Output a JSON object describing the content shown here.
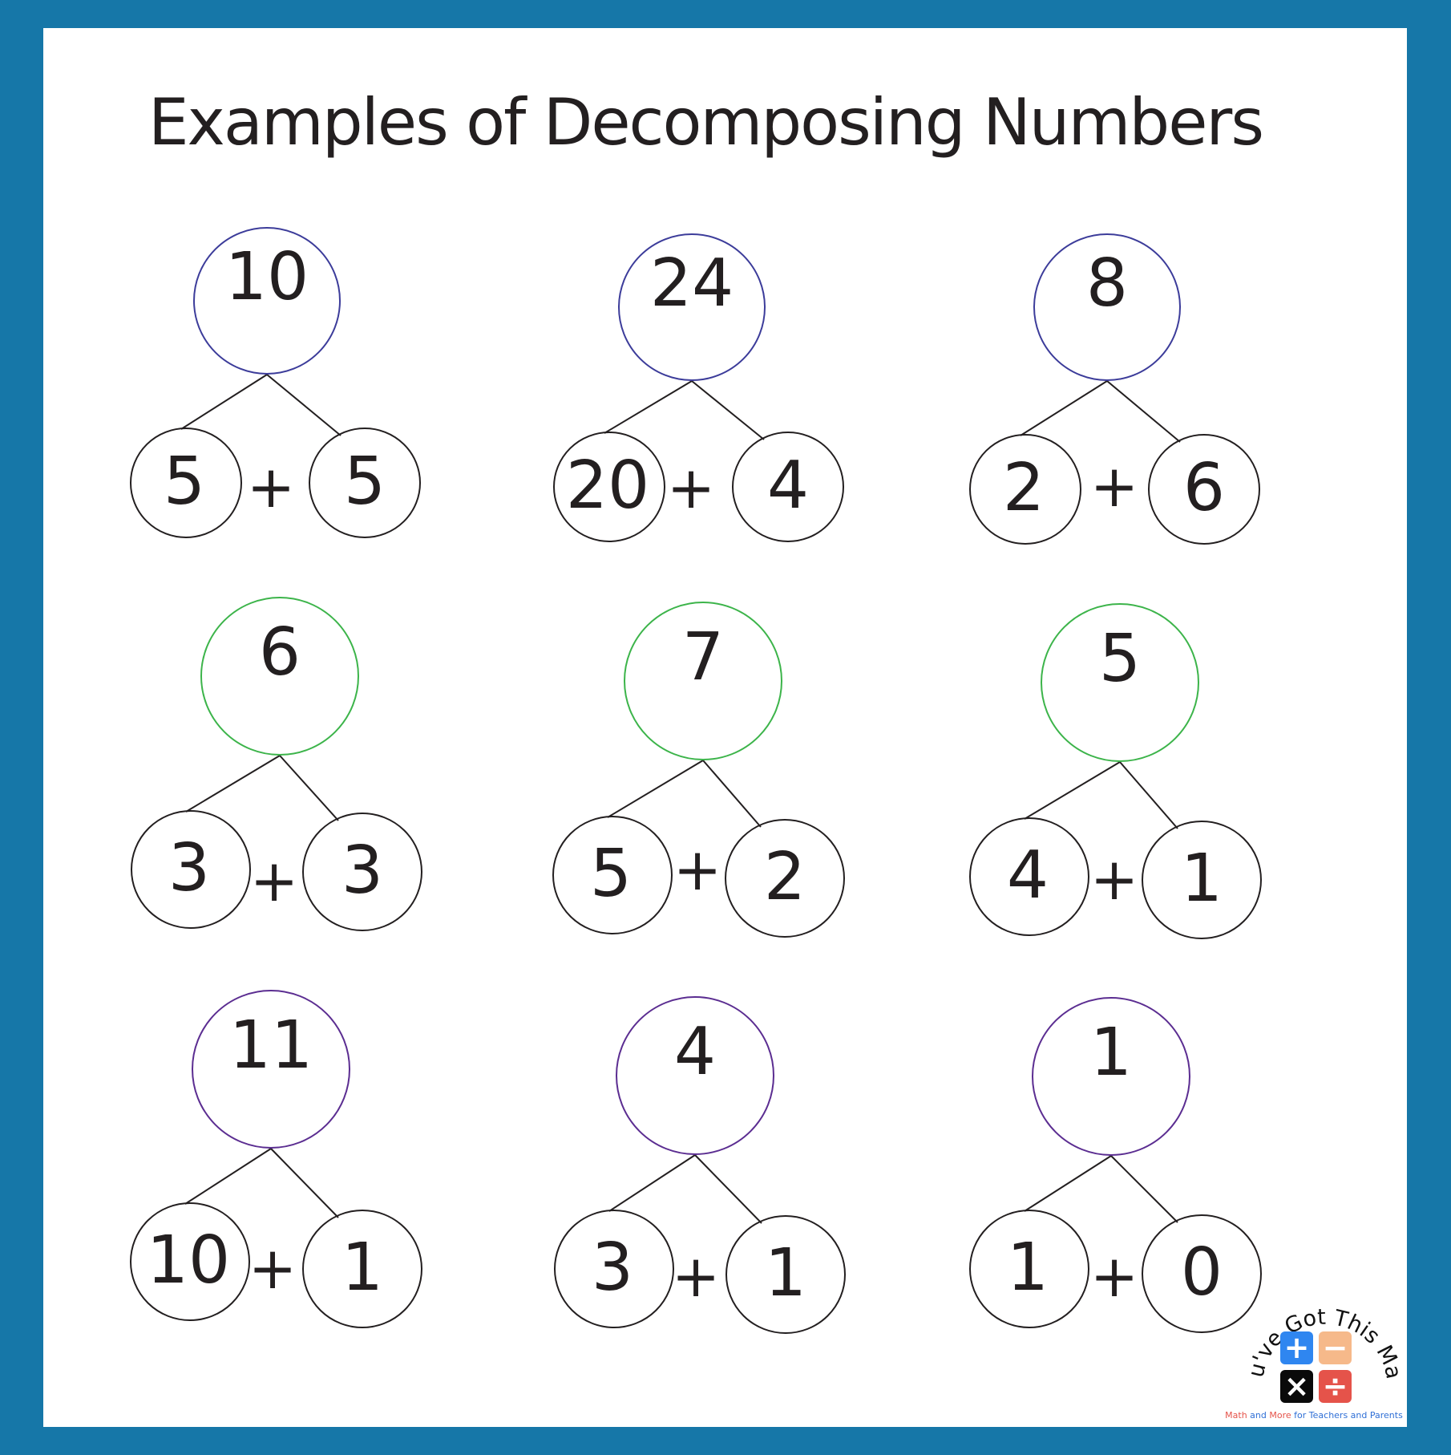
{
  "title": "Examples of Decomposing Numbers",
  "colors": {
    "border": "#1677a8",
    "row_colors": [
      "#3c3c9a",
      "#3cb44a",
      "#5b2d91"
    ],
    "child_stroke": "#231f20",
    "text": "#231f20"
  },
  "operator": "+",
  "bonds": [
    {
      "row": 1,
      "col": 1,
      "whole": "10",
      "parts": [
        "5",
        "5"
      ]
    },
    {
      "row": 1,
      "col": 2,
      "whole": "24",
      "parts": [
        "20",
        "4"
      ]
    },
    {
      "row": 1,
      "col": 3,
      "whole": "8",
      "parts": [
        "2",
        "6"
      ]
    },
    {
      "row": 2,
      "col": 1,
      "whole": "6",
      "parts": [
        "3",
        "3"
      ]
    },
    {
      "row": 2,
      "col": 2,
      "whole": "7",
      "parts": [
        "5",
        "2"
      ]
    },
    {
      "row": 2,
      "col": 3,
      "whole": "5",
      "parts": [
        "4",
        "1"
      ]
    },
    {
      "row": 3,
      "col": 1,
      "whole": "11",
      "parts": [
        "10",
        "1"
      ]
    },
    {
      "row": 3,
      "col": 2,
      "whole": "4",
      "parts": [
        "3",
        "1"
      ]
    },
    {
      "row": 3,
      "col": 3,
      "whole": "1",
      "parts": [
        "1",
        "0"
      ]
    }
  ],
  "logo": {
    "arc_text": "You've Got This Math",
    "tiles": [
      {
        "name": "plus",
        "symbol": "+",
        "color": "#2f86f0"
      },
      {
        "name": "minus",
        "symbol": "−",
        "color": "#f6b98a"
      },
      {
        "name": "times",
        "symbol": "×",
        "color": "#0a0a0a"
      },
      {
        "name": "divide",
        "symbol": "÷",
        "color": "#e5534a"
      }
    ],
    "tagline": [
      {
        "text": "Math",
        "color": "#e5534a"
      },
      {
        "text": " and ",
        "color": "#2f6fd6"
      },
      {
        "text": "More",
        "color": "#e5534a"
      },
      {
        "text": " for Teachers and Parents",
        "color": "#2f6fd6"
      }
    ]
  }
}
